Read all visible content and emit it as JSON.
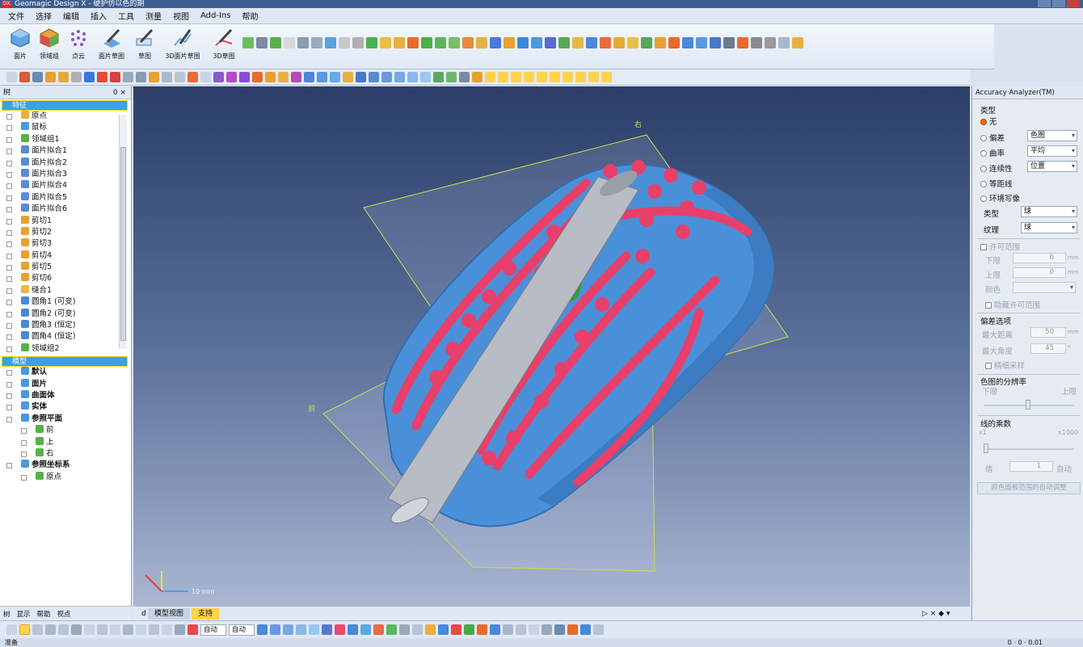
{
  "app": {
    "title": "Geomagic Design X - 硬护仿以色的期",
    "logo": "DX"
  },
  "menu": [
    "文件",
    "选择",
    "编辑",
    "插入",
    "工具",
    "测量",
    "视图",
    "Add-Ins",
    "帮助"
  ],
  "ribbon": [
    {
      "label": "面片",
      "icon": "mesh-icon"
    },
    {
      "label": "领域组",
      "icon": "region-group-icon"
    },
    {
      "label": "点云",
      "icon": "point-cloud-icon"
    },
    {
      "label": "面片草图",
      "icon": "mesh-sketch-icon"
    },
    {
      "label": "草图",
      "icon": "sketch-icon"
    },
    {
      "label": "3D面片草图",
      "icon": "3d-mesh-sketch-icon"
    },
    {
      "label": "3D草图",
      "icon": "3d-sketch-icon"
    }
  ],
  "tree_panel": {
    "title": "树",
    "pin": "0 ×",
    "section_features": "特征",
    "features": [
      {
        "label": "原点",
        "icon": "origin-icon"
      },
      {
        "label": "鼠标",
        "icon": "mesh-icon"
      },
      {
        "label": "领域组1",
        "icon": "region-group-icon"
      },
      {
        "label": "面片拟合1",
        "icon": "surface-fit-icon"
      },
      {
        "label": "面片拟合2",
        "icon": "surface-fit-icon"
      },
      {
        "label": "面片拟合3",
        "icon": "surface-fit-icon"
      },
      {
        "label": "面片拟合4",
        "icon": "surface-fit-icon"
      },
      {
        "label": "面片拟合5",
        "icon": "surface-fit-icon"
      },
      {
        "label": "面片拟合6",
        "icon": "surface-fit-icon"
      },
      {
        "label": "剪切1",
        "icon": "trim-icon"
      },
      {
        "label": "剪切2",
        "icon": "trim-icon"
      },
      {
        "label": "剪切3",
        "icon": "trim-icon"
      },
      {
        "label": "剪切4",
        "icon": "trim-icon"
      },
      {
        "label": "剪切5",
        "icon": "trim-icon"
      },
      {
        "label": "剪切6",
        "icon": "trim-icon"
      },
      {
        "label": "缝合1",
        "icon": "sew-icon"
      },
      {
        "label": "圆角1 (可变)",
        "icon": "fillet-icon"
      },
      {
        "label": "圆角2 (可变)",
        "icon": "fillet-icon"
      },
      {
        "label": "圆角3 (恒定)",
        "icon": "fillet-icon"
      },
      {
        "label": "圆角4 (恒定)",
        "icon": "fillet-icon"
      },
      {
        "label": "领域组2",
        "icon": "region-group-icon"
      }
    ],
    "section_model": "模型",
    "model": [
      {
        "label": "默认",
        "bold": true,
        "sub": false
      },
      {
        "label": "面片",
        "bold": true,
        "sub": false
      },
      {
        "label": "曲面体",
        "bold": true,
        "sub": false
      },
      {
        "label": "实体",
        "bold": true,
        "sub": false
      },
      {
        "label": "参照平面",
        "bold": true,
        "sub": false
      },
      {
        "label": "前",
        "bold": false,
        "sub": true
      },
      {
        "label": "上",
        "bold": false,
        "sub": true
      },
      {
        "label": "右",
        "bold": false,
        "sub": true
      },
      {
        "label": "参照坐标系",
        "bold": true,
        "sub": false
      },
      {
        "label": "原点",
        "bold": false,
        "sub": true
      }
    ],
    "tabs": [
      "树",
      "显示",
      "帮助",
      "视点"
    ]
  },
  "viewport": {
    "label_right": "右",
    "label_front": "前",
    "scale_text": "10 mm",
    "bg_top": "#2a3e68",
    "bg_bottom": "#aab6d2",
    "mesh_color": "#4a90d9",
    "deviation_color": "#e8406a"
  },
  "view_tabs": {
    "inactive_marker": "d",
    "tab1": "模型视图",
    "tab2": "支持",
    "controls": "▷ × ◆ ▾"
  },
  "accuracy": {
    "title": "Accuracy Analyzer(TM)",
    "type_label": "类型",
    "options": [
      {
        "label": "无",
        "selected": true
      },
      {
        "label": "偏差",
        "selected": false,
        "dropdown": "色图"
      },
      {
        "label": "曲率",
        "selected": false,
        "dropdown": "平均"
      },
      {
        "label": "连续性",
        "selected": false,
        "dropdown": "位置"
      },
      {
        "label": "等距线",
        "selected": false
      },
      {
        "label": "环境写像",
        "selected": false
      }
    ],
    "env_type_label": "类型",
    "env_type_value": "球",
    "texture_label": "纹理",
    "texture_value": "球",
    "tolerance_label": "许可范围",
    "lower_label": "下限",
    "lower_value": "0",
    "upper_label": "上限",
    "upper_value": "0",
    "unit": "mm",
    "color_label": "颜色",
    "hide_label": "隐藏许可范围",
    "dev_opts_label": "偏差选项",
    "max_dist_label": "最大距离",
    "max_dist_value": "50",
    "max_angle_label": "最大角度",
    "max_angle_value": "45",
    "angle_unit": "°",
    "fine_label": "精细采样",
    "colormap_res_label": "色图的分辨率",
    "res_low": "下限",
    "res_high": "上限",
    "line_mult_label": "线的乘数",
    "mult_min": "x1",
    "mult_max": "x1000",
    "value_label": "值",
    "value": "1",
    "auto_label": "自动",
    "auto_range_btn": "颜色面板范围的自动调整"
  },
  "bottom_toolbar": {
    "dropdown1": "自动",
    "dropdown2": "自动"
  },
  "status": {
    "text": "准备",
    "coords": "0 · 0 · 0.01"
  }
}
